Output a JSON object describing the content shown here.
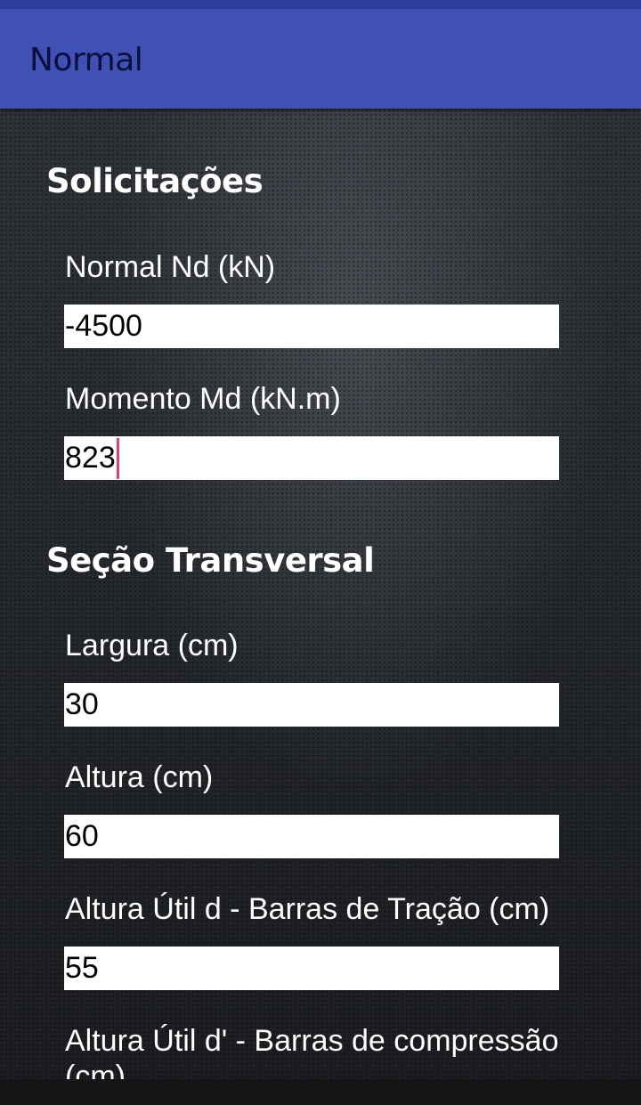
{
  "app_bar": {
    "title": "Normal"
  },
  "sections": [
    {
      "title": "Solicitações",
      "fields": [
        {
          "label": "Normal Nd (kN)",
          "value": "-4500"
        },
        {
          "label": "Momento Md (kN.m)",
          "value": "823",
          "focused": true
        }
      ]
    },
    {
      "title": "Seção Transversal",
      "fields": [
        {
          "label": "Largura (cm)",
          "value": "30"
        },
        {
          "label": "Altura (cm)",
          "value": "60"
        },
        {
          "label": "Altura Útil d - Barras de Tração (cm)",
          "value": "55"
        },
        {
          "label": "Altura Útil d' - Barras de compressão (cm)",
          "value": ""
        }
      ]
    }
  ],
  "colors": {
    "app_bar": "#3f51b5",
    "title_text": "#0b0d3a",
    "caret": "#e0407a"
  }
}
